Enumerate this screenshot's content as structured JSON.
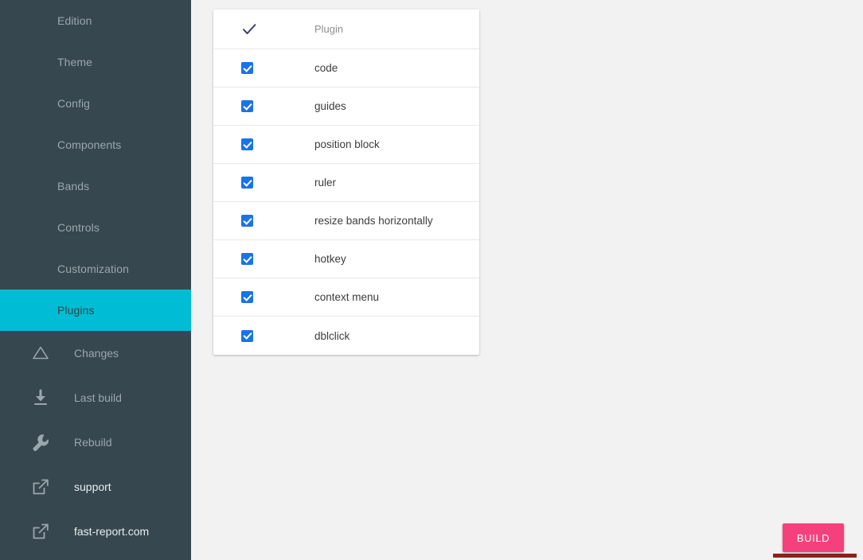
{
  "sidebar": {
    "nav_items": [
      {
        "label": "Edition",
        "active": false
      },
      {
        "label": "Theme",
        "active": false
      },
      {
        "label": "Config",
        "active": false
      },
      {
        "label": "Components",
        "active": false
      },
      {
        "label": "Bands",
        "active": false
      },
      {
        "label": "Controls",
        "active": false
      },
      {
        "label": "Customization",
        "active": false
      },
      {
        "label": "Plugins",
        "active": true
      }
    ],
    "tool_items": [
      {
        "label": "Changes",
        "icon": "triangle-outline-icon"
      },
      {
        "label": "Last build",
        "icon": "download-icon"
      },
      {
        "label": "Rebuild",
        "icon": "wrench-icon"
      },
      {
        "label": "support",
        "icon": "external-link-icon"
      },
      {
        "label": "fast-report.com",
        "icon": "external-link-icon"
      }
    ],
    "colors": {
      "background": "#37474f",
      "active": "#00bcd4",
      "text": "#9aa7ad"
    }
  },
  "main": {
    "background": "#f2f2f2",
    "plugin_table": {
      "header": {
        "check_icon": "checkmark-icon",
        "column_label": "Plugin"
      },
      "rows": [
        {
          "checked": true,
          "label": "code"
        },
        {
          "checked": true,
          "label": "guides"
        },
        {
          "checked": true,
          "label": "position block"
        },
        {
          "checked": true,
          "label": "ruler"
        },
        {
          "checked": true,
          "label": "resize bands horizontally"
        },
        {
          "checked": true,
          "label": "hotkey"
        },
        {
          "checked": true,
          "label": "context menu"
        },
        {
          "checked": true,
          "label": "dblclick"
        }
      ],
      "checkbox_color": "#1a73e8"
    }
  },
  "build": {
    "label": "BUILD",
    "color": "#f4417d",
    "underbar_color": "#8e1f1f"
  }
}
